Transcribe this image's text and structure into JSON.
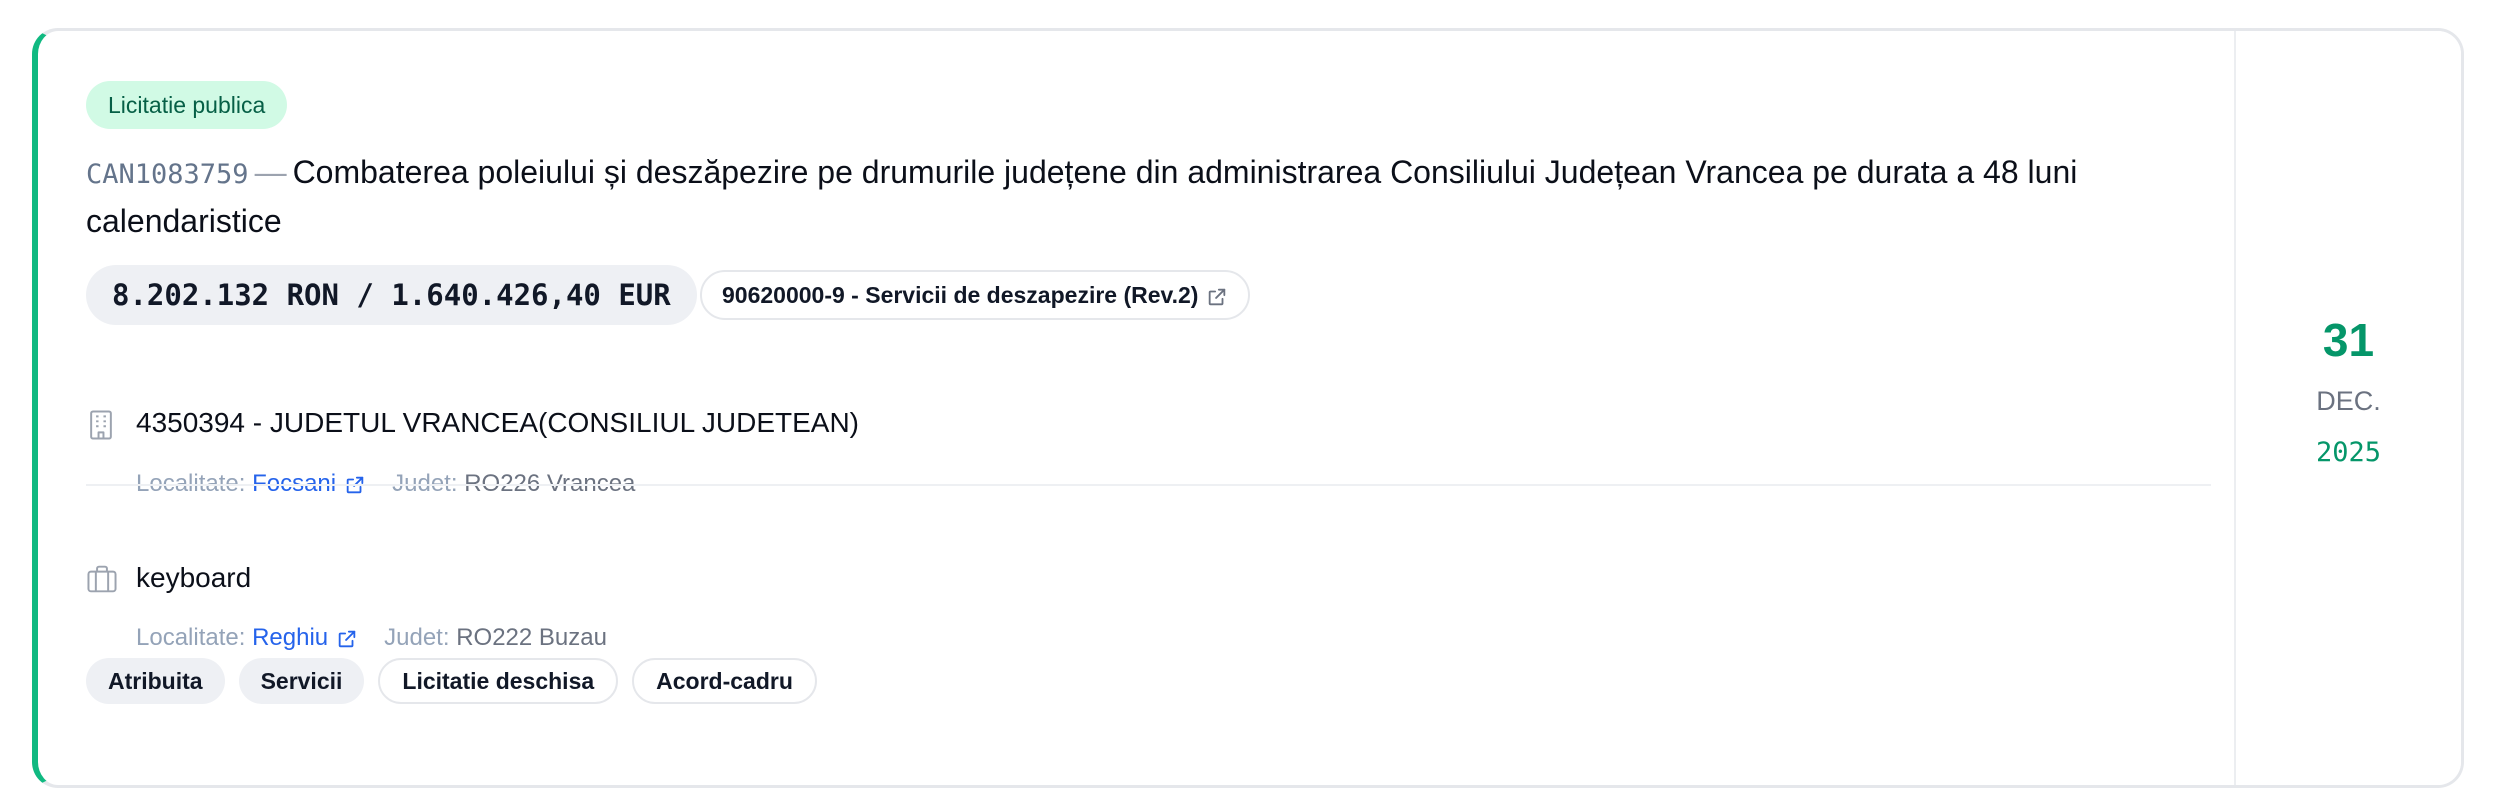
{
  "procedure_type": "Licitatie publica",
  "notice": {
    "code": "CAN1083759",
    "separator": "—",
    "title": "Combaterea poleiului și deszăpezire pe drumurile județene din administrarea Consiliului Județean Vrancea pe durata a 48 luni calendaristice"
  },
  "value_label": "8.202.132 RON / 1.640.426,40 EUR",
  "cpv_label": "90620000-9 - Servicii de deszapezire (Rev.2)",
  "authority": {
    "name": "4350394 - JUDETUL VRANCEA(CONSILIUL JUDETEAN)",
    "locality_label": "Localitate:",
    "locality": "Focsani",
    "county_label": "Judet:",
    "county": "RO226 Vrancea"
  },
  "supplier": {
    "name": "keyboard",
    "locality_label": "Localitate:",
    "locality": "Reghiu",
    "county_label": "Judet:",
    "county": "RO222 Buzau"
  },
  "tags": [
    {
      "label": "Atribuita",
      "style": "filled"
    },
    {
      "label": "Servicii",
      "style": "filled"
    },
    {
      "label": "Licitatie deschisa",
      "style": "outline"
    },
    {
      "label": "Acord-cadru",
      "style": "outline"
    }
  ],
  "date": {
    "day": "31",
    "month": "DEC.",
    "year": "2025"
  },
  "icons": {
    "authority": "building-icon",
    "supplier": "briefcase-icon",
    "external": "external-link-icon"
  },
  "colors": {
    "accent": "#10b981",
    "badge_bg": "#d1fae5",
    "badge_text": "#065f46",
    "link": "#2563eb",
    "date": "#059669"
  }
}
